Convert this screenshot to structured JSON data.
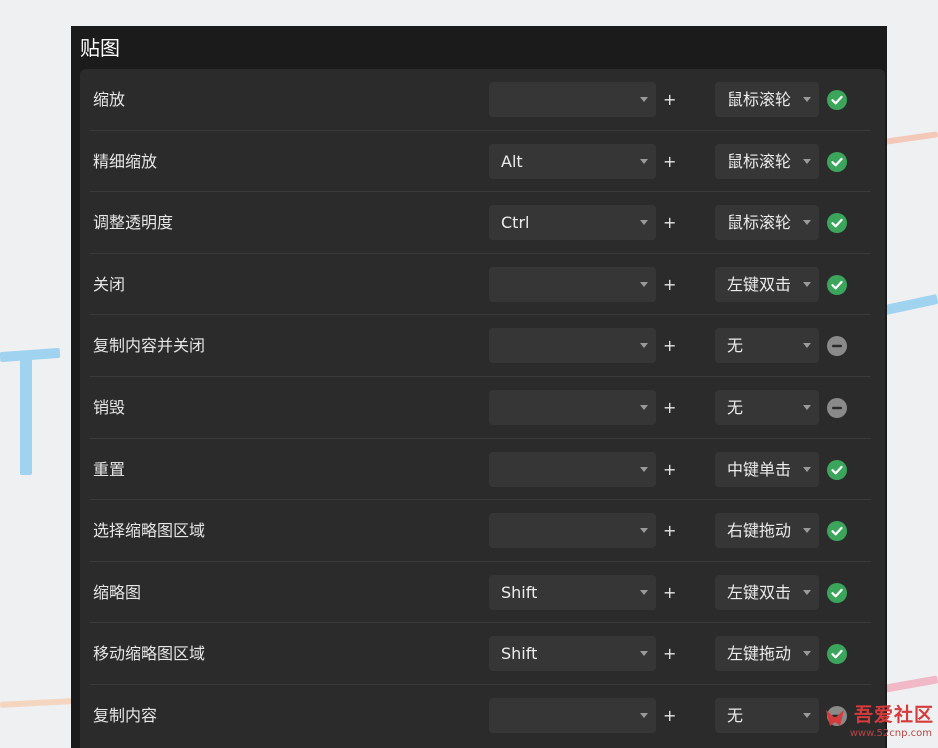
{
  "panel": {
    "title": "贴图"
  },
  "plus": "+",
  "rows": [
    {
      "label": "缩放",
      "modifier": "",
      "mouse": "鼠标滚轮",
      "status": "enabled"
    },
    {
      "label": "精细缩放",
      "modifier": "Alt",
      "mouse": "鼠标滚轮",
      "status": "enabled"
    },
    {
      "label": "调整透明度",
      "modifier": "Ctrl",
      "mouse": "鼠标滚轮",
      "status": "enabled"
    },
    {
      "label": "关闭",
      "modifier": "",
      "mouse": "左键双击",
      "status": "enabled"
    },
    {
      "label": "复制内容并关闭",
      "modifier": "",
      "mouse": "无",
      "status": "disabled"
    },
    {
      "label": "销毁",
      "modifier": "",
      "mouse": "无",
      "status": "disabled"
    },
    {
      "label": "重置",
      "modifier": "",
      "mouse": "中键单击",
      "status": "enabled"
    },
    {
      "label": "选择缩略图区域",
      "modifier": "",
      "mouse": "右键拖动",
      "status": "enabled"
    },
    {
      "label": "缩略图",
      "modifier": "Shift",
      "mouse": "左键双击",
      "status": "enabled"
    },
    {
      "label": "移动缩略图区域",
      "modifier": "Shift",
      "mouse": "左键拖动",
      "status": "enabled"
    },
    {
      "label": "复制内容",
      "modifier": "",
      "mouse": "无",
      "status": "disabled"
    }
  ],
  "watermark": {
    "title": "吾爱社区",
    "url": "www.52cnp.com"
  },
  "colors": {
    "enabled": "#3ba55c",
    "disabled": "#8a8a8a",
    "panel_bg": "#1b1b1b",
    "card_bg": "#2b2b2b",
    "combo_bg": "#363636"
  },
  "icons": {
    "enabled": "check-circle-icon",
    "disabled": "minus-circle-icon",
    "dropdown": "chevron-down-icon"
  }
}
